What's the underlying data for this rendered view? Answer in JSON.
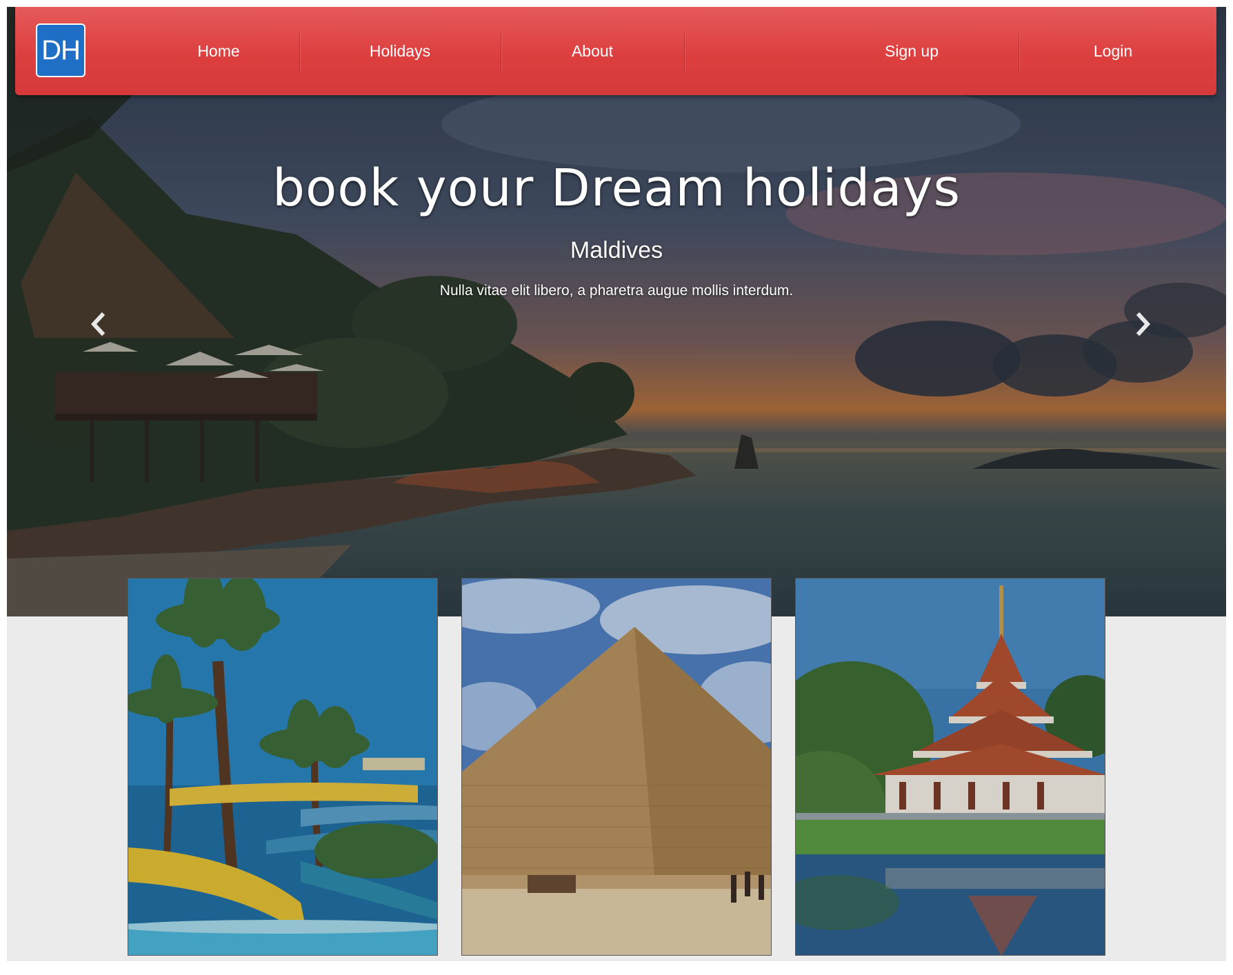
{
  "navbar": {
    "brand": "DH",
    "items": [
      {
        "label": "Home"
      },
      {
        "label": "Holidays"
      },
      {
        "label": "About"
      },
      {
        "label": "Sign up"
      },
      {
        "label": "Login"
      }
    ],
    "color": "#dd3f3f",
    "brand_color": "#1f6fc7"
  },
  "hero": {
    "title": "book your Dream holidays",
    "subtitle": "Maldives",
    "text": "Nulla vitae elit libero, a pharetra augue mollis interdum.",
    "prev_icon": "chevron-left-icon",
    "next_icon": "chevron-right-icon"
  },
  "cards": [
    {
      "image": "water-park-palm-trees"
    },
    {
      "image": "pyramid-of-giza"
    },
    {
      "image": "thai-temple-pagoda"
    }
  ]
}
